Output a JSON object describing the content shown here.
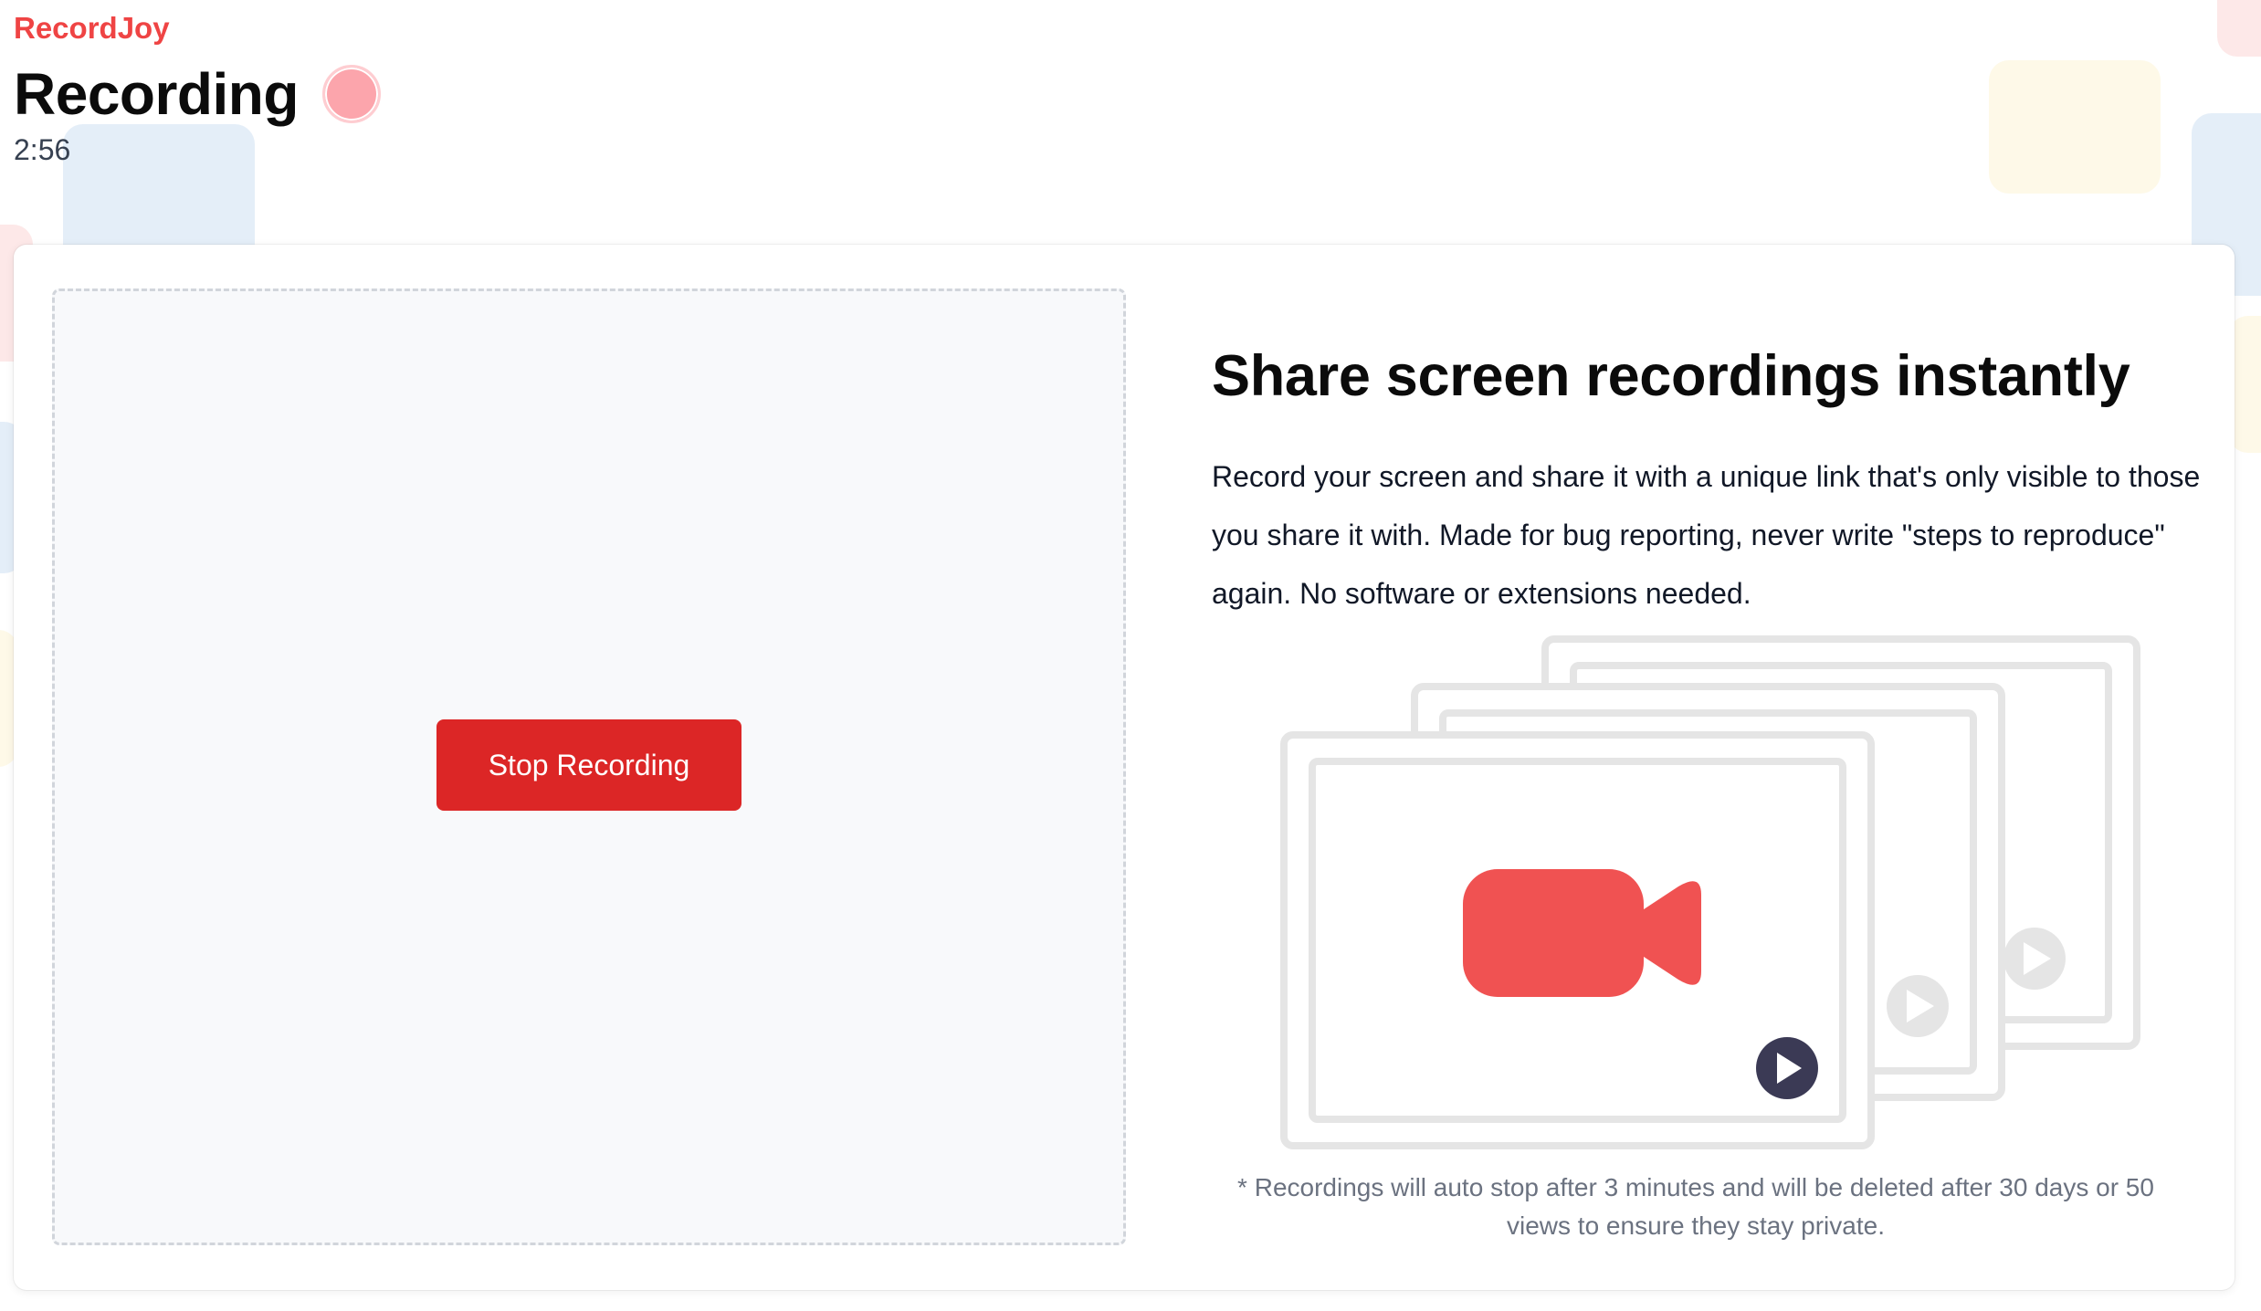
{
  "app": {
    "brand": "RecordJoy"
  },
  "header": {
    "title": "Recording",
    "timer": "2:56"
  },
  "recorder": {
    "stop_button_label": "Stop Recording"
  },
  "info": {
    "heading": "Share screen recordings instantly",
    "description": "Record your screen and share it with a unique link that's only visible to those you share it with. Made for bug reporting, never write \"steps to reproduce\" again. No software or extensions needed.",
    "footnote": "* Recordings will auto stop after 3 minutes and will be deleted after 30 days or 50 views to ensure they stay private."
  },
  "colors": {
    "brand": "#ef4444",
    "stop_button": "#dc2626",
    "recording_indicator": "#fca5ac",
    "camera_icon": "#f05252"
  }
}
